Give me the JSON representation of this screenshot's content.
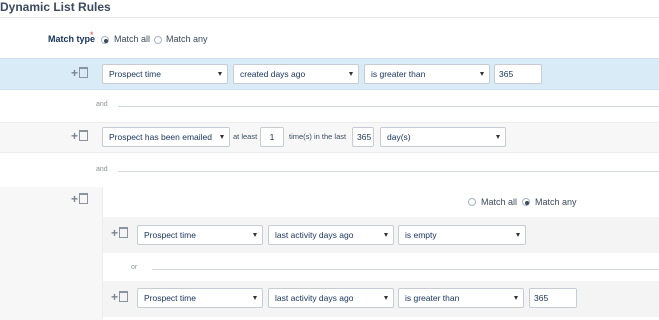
{
  "title": "Dynamic List Rules",
  "match_type": {
    "label": "Match type",
    "required_mark": "*",
    "options": [
      "Match all",
      "Match any"
    ],
    "selected": "Match all"
  },
  "rules": [
    {
      "field": "Prospect time",
      "operator": "created days ago",
      "comparison": "is greater than",
      "value": "365"
    },
    {
      "field": "Prospect has been emailed",
      "at_least_label": "at least",
      "count": "1",
      "times_label": "time(s) in the last",
      "period": "365",
      "unit": "day(s)"
    }
  ],
  "connector_and": "and",
  "group": {
    "match_options": [
      "Match all",
      "Match any"
    ],
    "selected": "Match any",
    "connector": "or",
    "rules": [
      {
        "field": "Prospect time",
        "operator": "last activity days ago",
        "comparison": "is empty"
      },
      {
        "field": "Prospect time",
        "operator": "last activity days ago",
        "comparison": "is greater than",
        "value": "365"
      }
    ]
  },
  "icons": [
    "plus-icon",
    "trash-icon",
    "chevron-down-icon"
  ]
}
